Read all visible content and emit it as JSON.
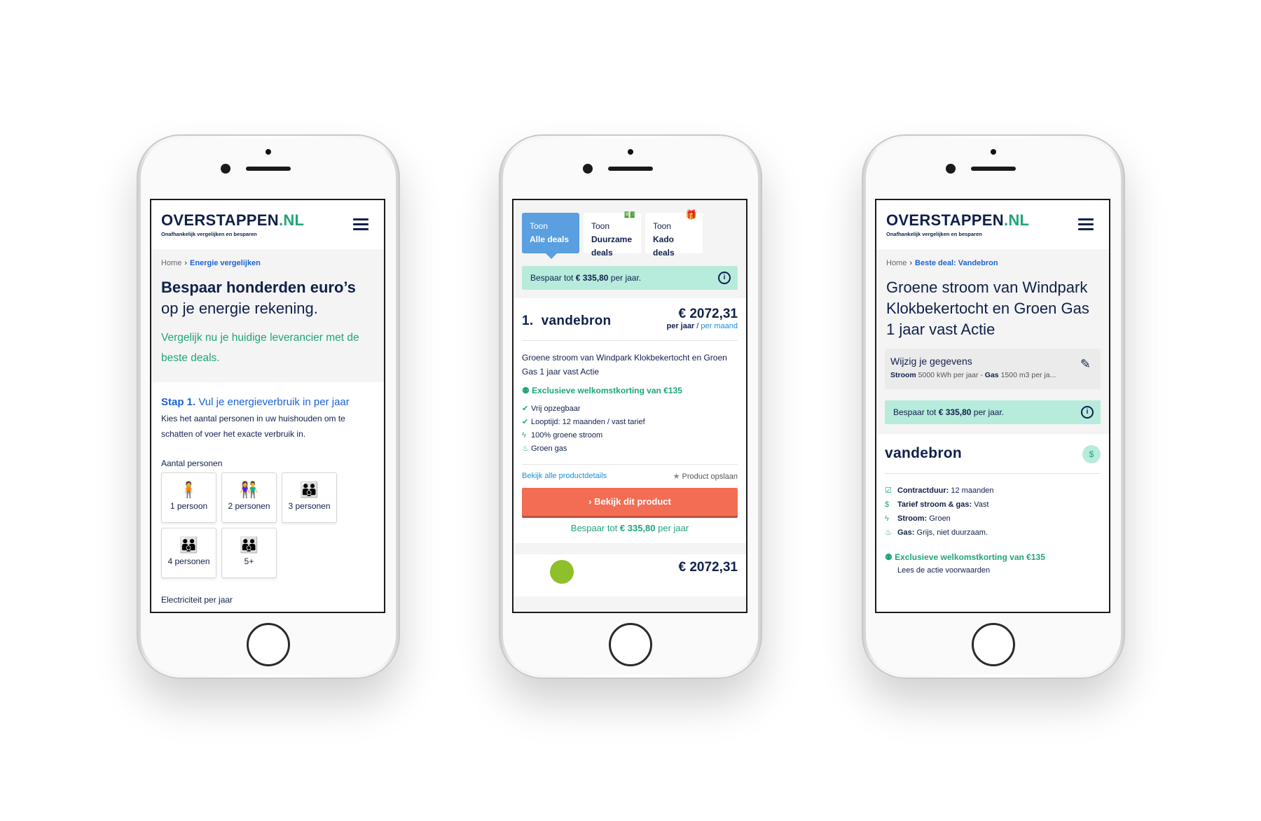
{
  "phone1": {
    "logo_text": "OVERSTAPPEN",
    "logo_suffix": ".NL",
    "logo_tagline": "Onafhankelijk vergelijken en besparen",
    "breadcrumb": {
      "home": "Home",
      "current": "Energie vergelijken"
    },
    "headline_bold": "Bespaar honderden euro’s",
    "headline_rest": " op je energie rekening.",
    "subheadline": "Vergelijk nu je huidige leverancier met de beste deals.",
    "step_bold": "Stap 1.",
    "step_rest": " Vul je energieverbruik in per jaar",
    "step_text": "Kies het aantal personen in uw huishouden om te schatten of voer het exacte verbruik in.",
    "persons_label": "Aantal personen",
    "persons": [
      {
        "label": "1 persoon",
        "icon": "person-1-icon"
      },
      {
        "label": "2 personen",
        "icon": "person-2-icon"
      },
      {
        "label": "3 personen",
        "icon": "person-3-icon"
      },
      {
        "label": "4 personen",
        "icon": "person-4-icon"
      },
      {
        "label": "5+",
        "icon": "person-5-icon"
      }
    ],
    "cut_label": "Electriciteit per jaar"
  },
  "phone2": {
    "tabs": [
      {
        "top": "Toon",
        "bottom": "Alle deals",
        "active": true
      },
      {
        "top": "Toon",
        "bottom": "Duurzame deals",
        "badge": "money-icon"
      },
      {
        "top": "Toon",
        "bottom": "Kado deals",
        "badge": "gift-icon"
      }
    ],
    "save_prefix": "Bespaar tot ",
    "save_amount": "€ 335,80",
    "save_suffix": " per jaar.",
    "rank": "1.",
    "brand": "vandebron",
    "price": "€ 2072,31",
    "per_year": "per jaar",
    "per_slash": " / ",
    "per_month": "per maand",
    "description": "Groene stroom van Windpark Klokbekertocht en Groen Gas 1 jaar vast Actie",
    "promo": "Exclusieve welkomstkorting van €135",
    "features": [
      "Vrij opzegbaar",
      "Looptijd: 12 maanden / vast tarief",
      "100% groene stroom",
      "Groen gas"
    ],
    "details_link": "Bekijk alle productdetails",
    "save_product": "Product opslaan",
    "cta": "Bekijk dit product",
    "bottom_save_prefix": "Bespaar tot ",
    "bottom_save_amount": "€ 335,80",
    "bottom_save_suffix": " per jaar",
    "next_price": "€ 2072,31"
  },
  "phone3": {
    "logo_text": "OVERSTAPPEN",
    "logo_suffix": ".NL",
    "logo_tagline": "Onafhankelijk vergelijken en besparen",
    "breadcrumb": {
      "home": "Home",
      "current": "Beste deal: Vandebron"
    },
    "title": "Groene stroom van Windpark Klokbekertocht en Groen Gas 1 jaar vast Actie",
    "wijzig_title": "Wijzig je gegevens",
    "wijzig_sub_b1": "Stroom",
    "wijzig_sub_1": " 5000 kWh per jaar - ",
    "wijzig_sub_b2": "Gas",
    "wijzig_sub_2": " 1500 m3 per ja...",
    "save_prefix": "Bespaar tot ",
    "save_amount": "€ 335,80",
    "save_suffix": " per jaar.",
    "brand": "vandebron",
    "details": [
      {
        "label": "Contractduur:",
        "value": " 12 maanden"
      },
      {
        "label": "Tarief stroom & gas:",
        "value": " Vast"
      },
      {
        "label": "Stroom:",
        "value": " Groen"
      },
      {
        "label": "Gas:",
        "value": " Grijs, niet duurzaam."
      }
    ],
    "promo": "Exclusieve welkomstkorting van €135",
    "promo_sub": "Lees de actie voorwaarden"
  }
}
